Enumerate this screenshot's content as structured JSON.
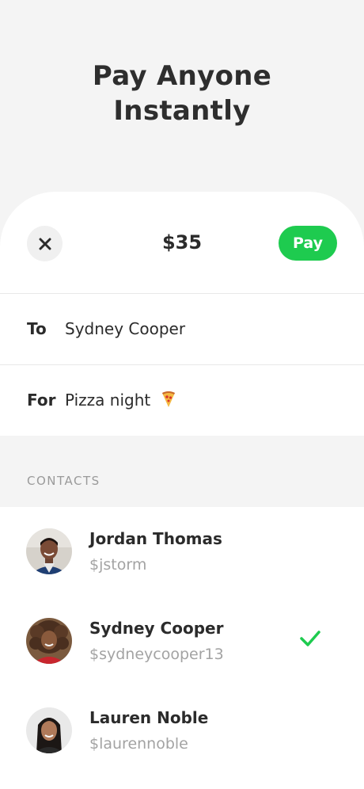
{
  "hero": {
    "title_line1": "Pay Anyone",
    "title_line2": "Instantly"
  },
  "payment": {
    "amount": "$35",
    "pay_label": "Pay",
    "close_icon": "close-icon",
    "to_label": "To",
    "to_value": "Sydney Cooper",
    "for_label": "For",
    "for_value": "Pizza night",
    "for_emoji_icon": "pizza-icon"
  },
  "contacts": {
    "section_label": "CONTACTS",
    "items": [
      {
        "name": "Jordan Thomas",
        "handle": "$jstorm",
        "selected": false
      },
      {
        "name": "Sydney Cooper",
        "handle": "$sydneycooper13",
        "selected": true
      },
      {
        "name": "Lauren Noble",
        "handle": "$laurennoble",
        "selected": false
      }
    ]
  },
  "colors": {
    "accent_green": "#1ecb4f",
    "background": "#f4f4f4",
    "sheet": "#ffffff",
    "muted_text": "#a3a3a3"
  }
}
